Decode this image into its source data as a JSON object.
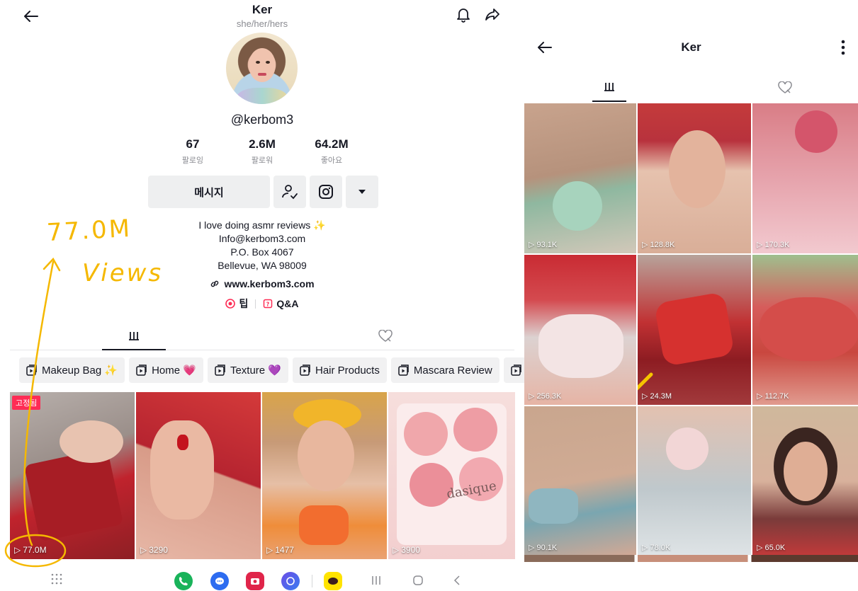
{
  "left": {
    "header": {
      "name": "Ker",
      "pronouns": "she/her/hers"
    },
    "profile": {
      "handle": "@kerbom3"
    },
    "stats": [
      {
        "value": "67",
        "label": "팔로잉"
      },
      {
        "value": "2.6M",
        "label": "팔로워"
      },
      {
        "value": "64.2M",
        "label": "좋아요"
      }
    ],
    "buttons": {
      "message": "메시지"
    },
    "bio": {
      "line1": "I love doing asmr reviews ✨",
      "line2": "Info@kerbom3.com",
      "line3": "P.O. Box  4067",
      "line4": "Bellevue, WA 98009",
      "website": "www.kerbom3.com"
    },
    "chips": {
      "tips": "팁",
      "qa": "Q&A"
    },
    "playlists": [
      "Makeup Bag ✨",
      "Home 💗",
      "Texture 💜",
      "Hair Products",
      "Mascara Review"
    ],
    "videos": [
      {
        "views": "77.0M",
        "badge": "고정됨"
      },
      {
        "views": "3290"
      },
      {
        "views": "1477"
      },
      {
        "views": "3900",
        "overlay": "dasique"
      }
    ],
    "annotation": {
      "line1": "77.0M",
      "line2": "Views"
    }
  },
  "right": {
    "header": {
      "title": "Ker"
    },
    "videos": [
      {
        "views": "93.1K"
      },
      {
        "views": "128.8K"
      },
      {
        "views": "170.3K"
      },
      {
        "views": "256.3K"
      },
      {
        "views": "24.3M"
      },
      {
        "views": "112.7K"
      },
      {
        "views": "90.1K"
      },
      {
        "views": "78.0K"
      },
      {
        "views": "65.0K"
      }
    ]
  },
  "colors": {
    "accent": "#fe2c55",
    "text": "#161823",
    "muted": "#8a8b91",
    "button_bg": "#eeeff0",
    "annotation": "#f5b800"
  }
}
